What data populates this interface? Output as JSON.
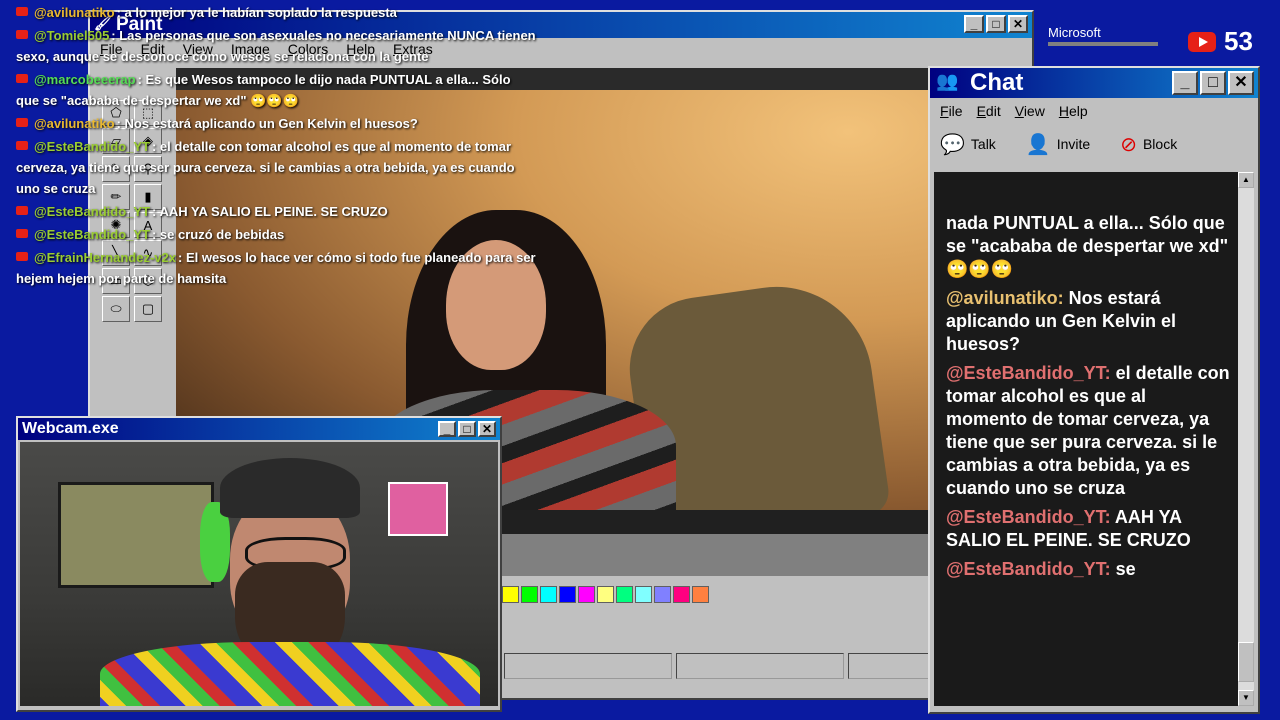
{
  "overlay_chat": [
    {
      "user": "@avilunatiko",
      "user_style": "gold",
      "text": ": a lo mejor ya le habían soplado la respuesta"
    },
    {
      "user": "@Tomiel505",
      "user_style": "",
      "text": ": Las personas que son asexuales no necesariamente NUNCA tienen sexo, aunque se desconoce cómo wesos se relaciona con la gente"
    },
    {
      "user": "@marcobeeerap",
      "user_style": "green",
      "text": ": Es que Wesos tampoco le dijo nada PUNTUAL a ella... Sólo que se \"acababa de despertar we xd\" 🙄🙄🙄"
    },
    {
      "user": "@avilunatiko",
      "user_style": "gold",
      "text": ": Nos estará aplicando un Gen Kelvin el huesos?"
    },
    {
      "user": "@EsteBandido_YT",
      "user_style": "",
      "text": ": el detalle con tomar alcohol es que al momento de tomar cerveza, ya tiene que ser pura cerveza. si le cambias a otra bebida, ya es cuando uno se cruza"
    },
    {
      "user": "@EsteBandido_YT",
      "user_style": "",
      "text": ": AAH YA SALIO EL PEINE. SE CRUZO"
    },
    {
      "user": "@EsteBandido_YT",
      "user_style": "",
      "text": ": se cruzó de bebidas"
    },
    {
      "user": "@EfrainHernandez-v2x",
      "user_style": "",
      "text": ": El wesos lo hace ver cómo si todo fue planeado para ser hejem hejem por parte de hamsita"
    }
  ],
  "top_right": {
    "brand": "Microsoft",
    "viewer_count": "53"
  },
  "paint": {
    "title": "Paint",
    "menu": [
      "File",
      "Edit",
      "View",
      "Image",
      "Colors",
      "Help",
      "Extras"
    ],
    "palette": [
      "#ffff00",
      "#00ff00",
      "#00ffff",
      "#0000ff",
      "#ff00ff",
      "#ffff80",
      "#00ff80",
      "#80ffff",
      "#8080ff",
      "#ff0080",
      "#ff8040"
    ]
  },
  "chat": {
    "title": "Chat",
    "menu": [
      "File",
      "Edit",
      "View",
      "Help"
    ],
    "tools": [
      {
        "label": "Talk",
        "icon": "talk-icon"
      },
      {
        "label": "Invite",
        "icon": "invite-icon"
      },
      {
        "label": "Block",
        "icon": "block-icon"
      }
    ],
    "messages": [
      {
        "user": "",
        "user_color": "",
        "text": "nada PUNTUAL a ella... Sólo que se \"acababa de despertar we xd\" 🙄🙄🙄"
      },
      {
        "user": "@avilunatiko:",
        "user_color": "gold",
        "text": " Nos estará aplicando un Gen Kelvin el huesos?"
      },
      {
        "user": "@EsteBandido_YT:",
        "user_color": "red",
        "text": " el detalle con tomar alcohol es que al momento de tomar cerveza, ya tiene que ser pura cerveza. si le cambias a otra bebida, ya es cuando uno se cruza"
      },
      {
        "user": "@EsteBandido_YT:",
        "user_color": "red",
        "text": " AAH YA SALIO EL PEINE. SE CRUZO"
      },
      {
        "user": "@EsteBandido_YT:",
        "user_color": "red",
        "text": " se"
      }
    ]
  },
  "webcam": {
    "title": "Webcam.exe"
  }
}
